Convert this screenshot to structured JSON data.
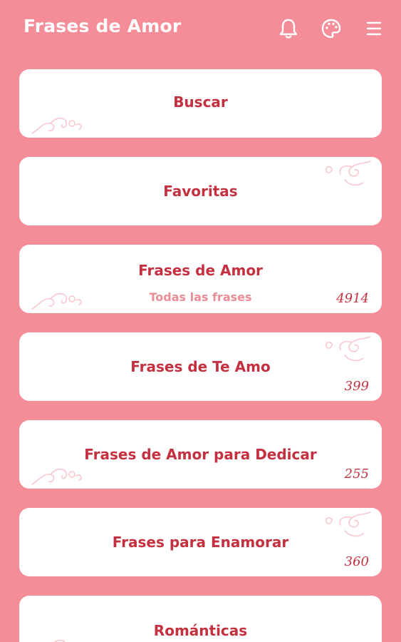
{
  "app_bar": {
    "title": "Frases de Amor",
    "icons": [
      "bell-icon",
      "palette-icon",
      "menu-icon"
    ]
  },
  "colors": {
    "background": "#F58D98",
    "card": "#FFFFFF",
    "title_text": "#C4303F",
    "subtitle_text": "#EC8C95"
  },
  "categories": [
    {
      "title": "Buscar",
      "subtitle": "",
      "count": ""
    },
    {
      "title": "Favoritas",
      "subtitle": "",
      "count": ""
    },
    {
      "title": "Frases de Amor",
      "subtitle": "Todas las frases",
      "count": "4914"
    },
    {
      "title": "Frases de Te Amo",
      "subtitle": "",
      "count": "399"
    },
    {
      "title": "Frases de Amor para Dedicar",
      "subtitle": "",
      "count": "255"
    },
    {
      "title": "Frases para Enamorar",
      "subtitle": "",
      "count": "360"
    },
    {
      "title": "Románticas",
      "subtitle": "",
      "count": ""
    }
  ]
}
